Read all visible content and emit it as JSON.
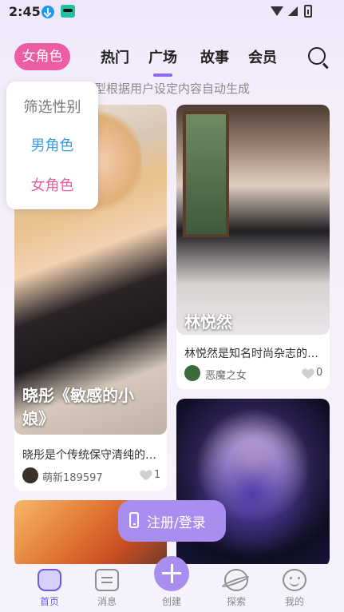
{
  "status_bar": {
    "time": "2:45"
  },
  "top_nav": {
    "gender_filter": "女角色",
    "tabs": [
      {
        "label": "热门"
      },
      {
        "label": "广场",
        "active": true
      },
      {
        "label": "故事"
      },
      {
        "label": "会员"
      }
    ]
  },
  "notice": "型根据用户设定内容自动生成",
  "gender_dropdown": {
    "title": "筛选性别",
    "options": [
      "男角色",
      "女角色"
    ]
  },
  "cards": [
    {
      "title": "晓彤《敏感的小娘》",
      "title_line1": "晓彤《敏感的小",
      "title_line2": "娘》",
      "desc": "晓彤是个传统保守清纯的…",
      "author": "萌新189597",
      "likes": "1"
    },
    {
      "title": "林悦然",
      "desc": "林悦然是知名时尚杂志的…",
      "author": "恶魔之女",
      "likes": "0"
    }
  ],
  "register_button": "注册/登录",
  "bottom_nav": {
    "items": [
      "首页",
      "消息",
      "创建",
      "探索",
      "我的"
    ]
  },
  "colors": {
    "accent_purple": "#8b6cf2",
    "gender_pill_pink": "#ec5da3",
    "male_blue": "#3aa0e6",
    "button_lavender": "#a98ef0"
  }
}
